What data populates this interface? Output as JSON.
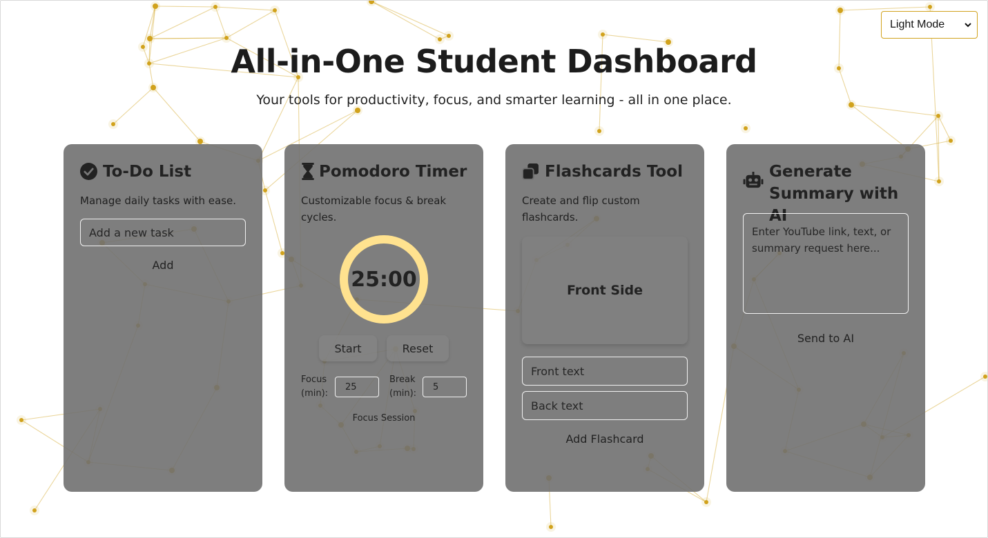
{
  "theme_select": {
    "value": "Light Mode"
  },
  "header": {
    "title": "All-in-One Student Dashboard",
    "subtitle": "Your tools for productivity, focus, and smarter learning - all in one place."
  },
  "todo": {
    "icon": "check-circle-icon",
    "title": "To-Do List",
    "description": "Manage daily tasks with ease.",
    "task_input_placeholder": "Add a new task",
    "add_label": "Add"
  },
  "pomodoro": {
    "icon": "hourglass-icon",
    "title": "Pomodoro Timer",
    "description": "Customizable focus & break cycles.",
    "time": "25:00",
    "start_label": "Start",
    "reset_label": "Reset",
    "focus_label": "Focus (min):",
    "focus_value": "25",
    "break_label": "Break (min):",
    "break_value": "5",
    "session_label": "Focus Session"
  },
  "flashcards": {
    "icon": "cards-stack-icon",
    "title": "Flashcards Tool",
    "description": "Create and flip custom flashcards.",
    "card_face": "Front Side",
    "front_placeholder": "Front text",
    "back_placeholder": "Back text",
    "add_label": "Add Flashcard"
  },
  "ai_summary": {
    "icon": "robot-icon",
    "title": "Generate Summary with AI",
    "input_placeholder": "Enter YouTube link, text, or summary request here...",
    "send_label": "Send to AI"
  },
  "colors": {
    "accent_gold": "#d1a21c",
    "card_gray": "#707070",
    "timer_ring": "#ffe28f"
  }
}
